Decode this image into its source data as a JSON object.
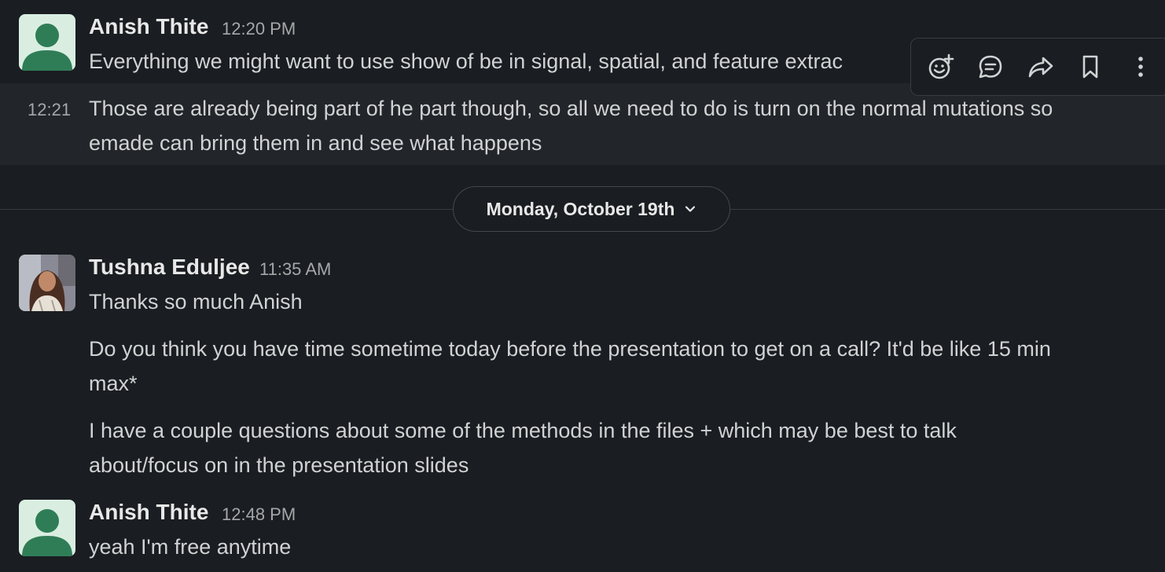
{
  "messages": [
    {
      "sender": "Anish Thite",
      "time": "12:20 PM",
      "text": "Everything we might want to use show of be in signal, spatial, and feature extrac"
    },
    {
      "time": "12:21",
      "text_line1": "Those are already being part of he part though, so all we need to do is turn on the normal mutations so",
      "text_line2": "emade can bring them in and see what happens"
    }
  ],
  "date_divider": {
    "label": "Monday, October 19th"
  },
  "messages2": [
    {
      "sender": "Tushna Eduljee",
      "time": "11:35 AM",
      "text1": "Thanks so much Anish",
      "text2_line1": "Do you think you have time sometime today before the presentation to get on a call? It'd be like 15 min",
      "text2_line2": "max*",
      "text3_line1": "I have a couple questions about some of the methods in the files + which may be best to talk",
      "text3_line2": "about/focus on in the presentation slides"
    },
    {
      "sender": "Anish Thite",
      "time": "12:48 PM",
      "text": "yeah I'm free anytime"
    }
  ],
  "toolbar": {
    "icons": [
      "add-reaction-icon",
      "reply-in-thread-icon",
      "share-icon",
      "bookmark-icon",
      "more-actions-icon"
    ]
  },
  "colors": {
    "background": "#1a1d21",
    "hover_background": "#222529",
    "default_avatar_bg": "#d9eee1",
    "default_avatar_fg": "#2f7d57"
  }
}
